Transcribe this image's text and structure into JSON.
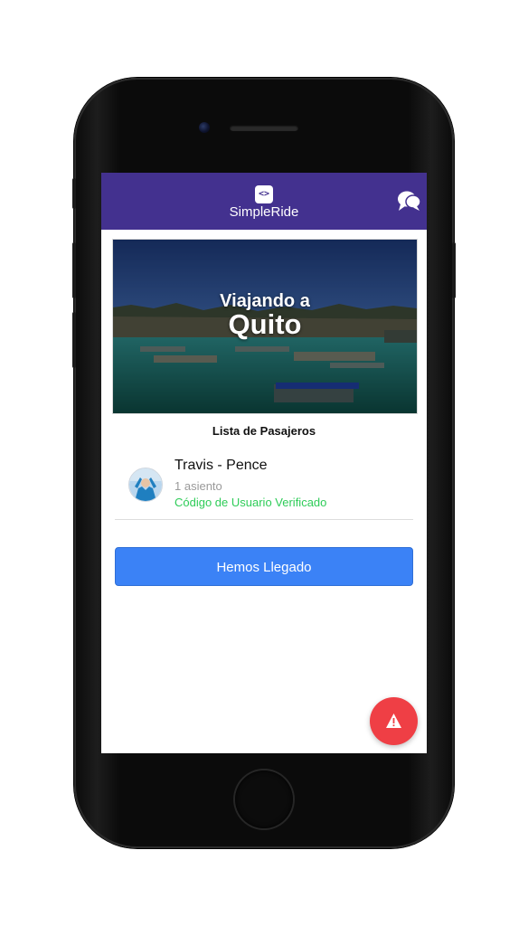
{
  "app": {
    "name": "SimpleRide",
    "logo_glyph": "<>",
    "brand_color": "#43318f"
  },
  "navbar": {
    "chat_icon": "chat-bubbles-icon"
  },
  "hero": {
    "line1": "Viajando a",
    "line2": "Quito"
  },
  "passengers": {
    "title": "Lista de Pasajeros",
    "items": [
      {
        "name": "Travis - Pence",
        "seats": "1 asiento",
        "status": "Código de Usuario Verificado",
        "status_color": "#2ecc58"
      }
    ]
  },
  "actions": {
    "arrived_label": "Hemos Llegado",
    "arrived_color": "#3b82f6",
    "alert_icon": "warning-icon",
    "alert_color": "#ef3f45"
  }
}
